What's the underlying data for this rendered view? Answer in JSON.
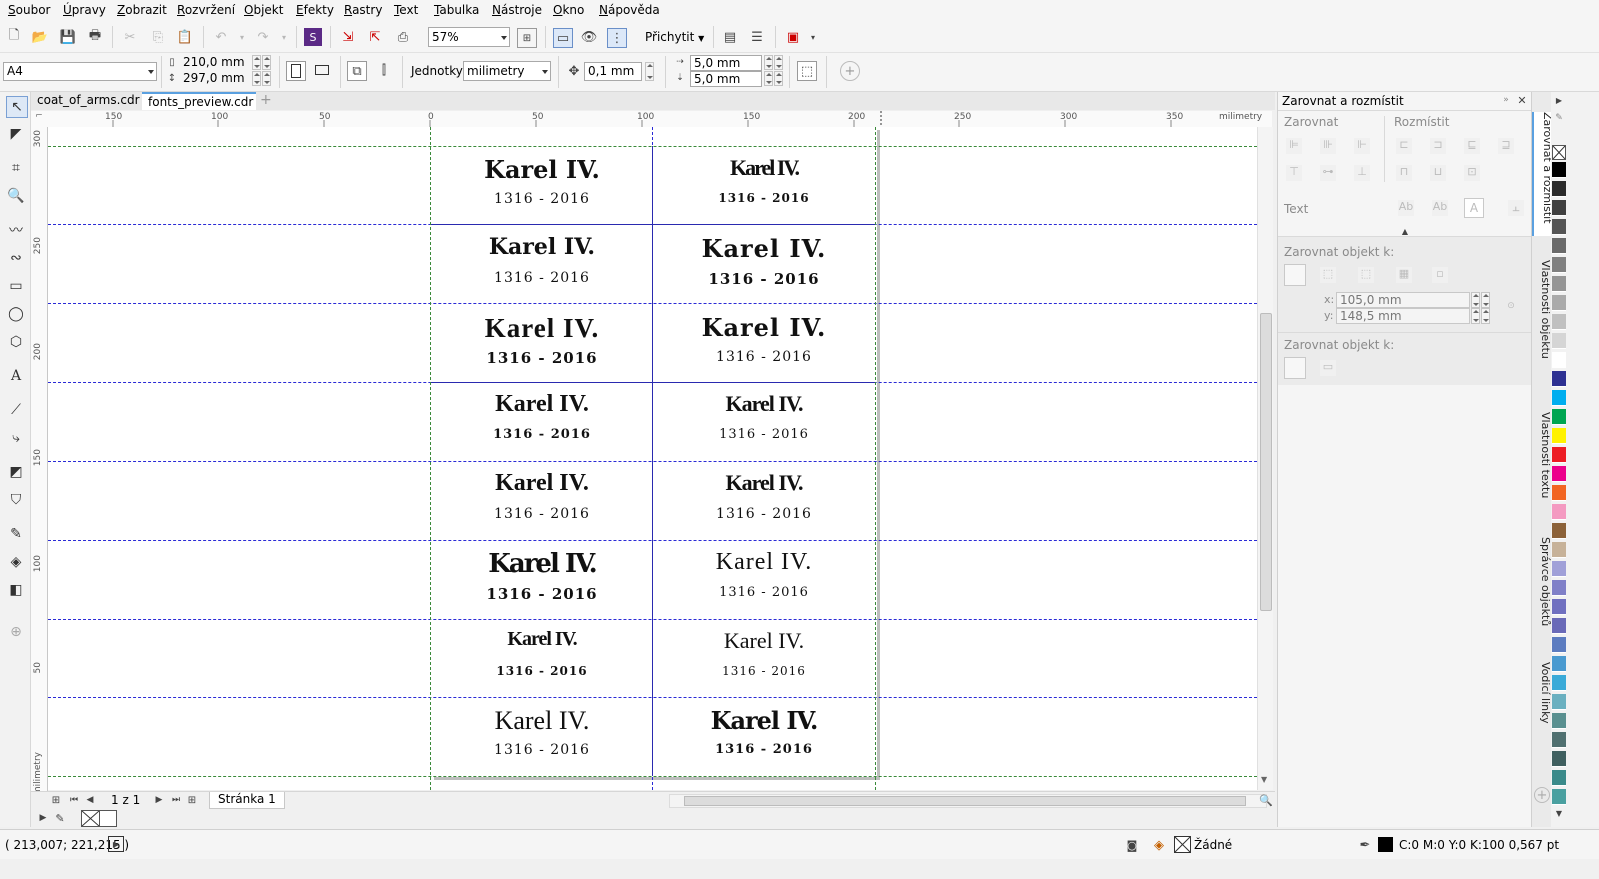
{
  "menu": [
    "Soubor",
    "Úpravy",
    "Zobrazit",
    "Rozvržení",
    "Objekt",
    "Efekty",
    "Rastry",
    "Text",
    "Tabulka",
    "Nástroje",
    "Okno",
    "Nápověda"
  ],
  "toolbar": {
    "zoom": "57%",
    "snap_label": "Přichytit"
  },
  "propertybar": {
    "page_size": "A4",
    "width": "210,0 mm",
    "height": "297,0 mm",
    "units_label": "Jednotky:",
    "units_value": "milimetry",
    "nudge": "0,1 mm",
    "dup_x": "5,0 mm",
    "dup_y": "5,0 mm"
  },
  "doc_tabs": [
    "coat_of_arms.cdr",
    "fonts_preview.cdr"
  ],
  "ruler": {
    "h_labels": [
      "150",
      "100",
      "50",
      "0",
      "50",
      "100",
      "150",
      "200",
      "250",
      "300",
      "350"
    ],
    "h_unit": "milimetry",
    "v_labels": [
      "300",
      "250",
      "200",
      "150",
      "100",
      "50"
    ],
    "v_unit": "milimetry"
  },
  "previews": {
    "name": "Karel IV.",
    "years": "1316 - 2016"
  },
  "bottom_nav": {
    "page_count": "1 z 1",
    "page_tab": "Stránka 1"
  },
  "status": {
    "coords": "( 213,007; 221,215 )",
    "fill_label": "Žádné",
    "outline_info": "C:0 M:0 Y:0 K:100  0,567 pt"
  },
  "docker": {
    "title": "Zarovnat a rozmístit",
    "align_label": "Zarovnat",
    "distribute_label": "Rozmístit",
    "text_label": "Text",
    "align_to_label": "Zarovnat objekt k:",
    "x_value": "105,0 mm",
    "y_value": "148,5 mm",
    "x_label": "x:",
    "y_label": "y:",
    "distribute_to_label": "Zarovnat objekt k:"
  },
  "docker_tabs": [
    "Zarovnat a rozmístit",
    "Vlastnosti objektu",
    "Vlastnosti textu",
    "Správce objektů",
    "Vodicí linky"
  ],
  "palette_colors": [
    "#000000",
    "#2b2b2b",
    "#404040",
    "#555555",
    "#6a6a6a",
    "#808080",
    "#959595",
    "#aaaaaa",
    "#c0c0c0",
    "#d5d5d5",
    "#ffffff",
    "#2e3192",
    "#00aeef",
    "#00a651",
    "#fff200",
    "#ed1c24",
    "#ec008c",
    "#f26522",
    "#f49ac1",
    "#8c6239",
    "#c7b299",
    "#a0a0d8",
    "#8080c8",
    "#7070c0",
    "#6a6ab8",
    "#5c7cc0",
    "#4a9ad0",
    "#3aaad8",
    "#6ab0c0",
    "#5a9090",
    "#507070",
    "#406060",
    "#3a8a8a",
    "#4aa0a0"
  ]
}
